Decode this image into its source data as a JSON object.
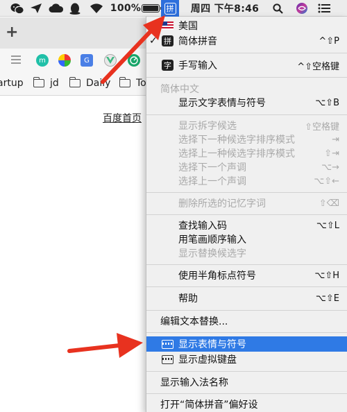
{
  "menubar": {
    "battery_percent": "100%",
    "battery_level": 1.0,
    "ime_glyph": "拼",
    "clock": "周四 下午8:46",
    "icons": [
      "wechat-icon",
      "send-icon",
      "cloud-icon",
      "qq-icon",
      "wifi-icon",
      "battery-icon",
      "search-icon",
      "siri-icon",
      "control-list-icon"
    ]
  },
  "browser": {
    "new_tab": "+",
    "bookmarks": [
      {
        "label": "artup"
      },
      {
        "label": "jd"
      },
      {
        "label": "Daily"
      },
      {
        "label": "To"
      }
    ],
    "page_link": "百度首页"
  },
  "menu": {
    "item_us": "美国",
    "item_pinyin": "简体拼音",
    "item_pinyin_check": "✓",
    "item_pinyin_shortcut": "^⇧P",
    "item_pinyin_icon": "拼",
    "item_handwrite": "手写输入",
    "item_handwrite_icon": "字",
    "item_handwrite_shortcut": "^⇧空格键",
    "section_simplified": "简体中文",
    "item_show_emoji_text": "显示文字表情与符号",
    "item_show_emoji_text_shortcut": "⌥⇧B",
    "item_show_split": "显示拆字候选",
    "item_show_split_shortcut": "⇧空格键",
    "item_next_sort": "选择下一种候选字排序模式",
    "item_next_sort_shortcut": "⇥",
    "item_prev_sort": "选择上一种候选字排序模式",
    "item_prev_sort_shortcut": "⇧⇥",
    "item_next_tone": "选择下一个声调",
    "item_next_tone_shortcut": "⌥→",
    "item_prev_tone": "选择上一个声调",
    "item_prev_tone_shortcut": "⌥⇧←",
    "item_delete_memory": "删除所选的记忆字词",
    "item_delete_memory_shortcut": "⇧⌫",
    "item_find_code": "查找输入码",
    "item_find_code_shortcut": "⌥⇧L",
    "item_stroke_order": "用笔画顺序输入",
    "item_show_alt": "显示替换候选字",
    "item_half_width": "使用半角标点符号",
    "item_half_width_shortcut": "⌥⇧H",
    "item_help": "帮助",
    "item_help_shortcut": "⌥⇧E",
    "item_edit_replace": "编辑文本替换...",
    "item_show_emoji": "显示表情与符号",
    "item_show_keyboard": "显示虚拟键盘",
    "item_show_ime_name": "显示输入法名称",
    "item_open_prefs": "打开“简体拼音”偏好设"
  },
  "colors": {
    "highlight": "#2f7ae5",
    "arrow": "#e8321f",
    "ime_tile": "#2d6fdc"
  }
}
